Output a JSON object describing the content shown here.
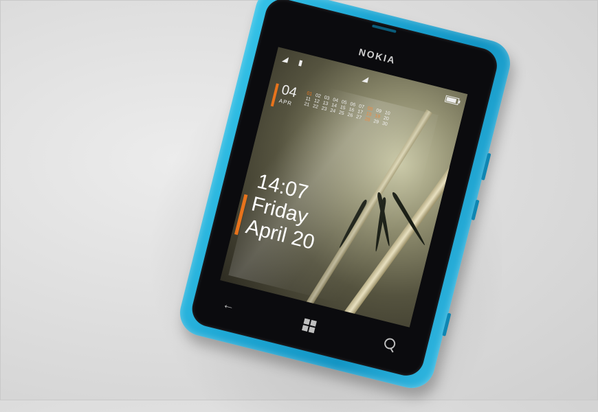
{
  "phone": {
    "brand": "NOKIA",
    "color": "#1ea7d4"
  },
  "lockscreen": {
    "calendar": {
      "day": "04",
      "month": "APR",
      "rows": [
        [
          "01",
          "02",
          "03",
          "04",
          "05",
          "06",
          "07",
          "08",
          "09",
          "10"
        ],
        [
          "11",
          "12",
          "13",
          "14",
          "15",
          "16",
          "17",
          "18",
          "19",
          "20"
        ],
        [
          "21",
          "22",
          "23",
          "24",
          "25",
          "26",
          "27",
          "28",
          "29",
          "30"
        ]
      ],
      "accent_color": "#e8731c"
    },
    "clock": {
      "time": "14:07",
      "day": "Friday",
      "date": "April 20"
    }
  },
  "navigation": {
    "back": "back-icon",
    "start": "windows-icon",
    "search": "search-icon"
  }
}
